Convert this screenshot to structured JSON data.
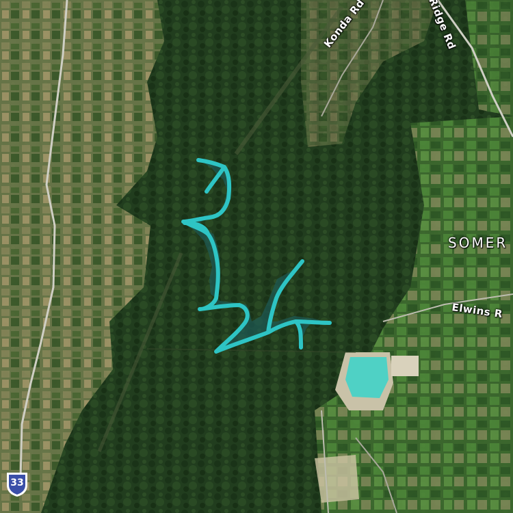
{
  "map": {
    "type": "satellite",
    "colors": {
      "forest": "#1f3a1c",
      "farmland": "#6f7a4a",
      "water_highlight": "#2ec4c4",
      "quarry_water": "#4fd1c5",
      "route_shield": "#3a4fa8"
    },
    "labels": {
      "konda_road": "Konda Rd",
      "ridge_road": "Ridge Rd",
      "somersby": "SOMER",
      "elwins_road": "Elwins R"
    },
    "route_shield": {
      "number": "33",
      "icon": "route-shield-icon"
    },
    "highlighted_feature": {
      "type": "reservoir",
      "color": "#2ec4c4"
    }
  }
}
